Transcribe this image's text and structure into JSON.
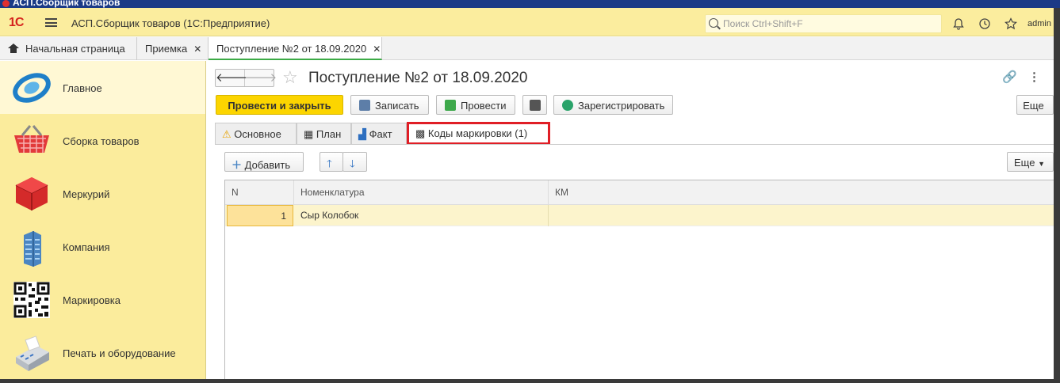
{
  "os": {
    "title": "АСП.Сборщик товаров"
  },
  "header": {
    "logo": "1С",
    "app_title": "АСП.Сборщик товаров  (1С:Предприятие)",
    "search_placeholder": "Поиск Ctrl+Shift+F",
    "user": "admin",
    "icons": [
      "bell-icon",
      "history-icon",
      "star-icon"
    ]
  },
  "open_windows": [
    {
      "label": "Начальная страница",
      "icon": "home-icon"
    },
    {
      "label": "Приемка",
      "closable": true
    },
    {
      "label": "Поступление №2 от 18.09.2020",
      "closable": true,
      "active": true
    }
  ],
  "sidebar": {
    "items": [
      {
        "label": "Главное",
        "icon": "main-section-icon",
        "active": true
      },
      {
        "label": "Сборка товаров",
        "icon": "basket-icon"
      },
      {
        "label": "Меркурий",
        "icon": "cube-icon"
      },
      {
        "label": "Компания",
        "icon": "building-icon"
      },
      {
        "label": "Маркировка",
        "icon": "qr-code-icon"
      },
      {
        "label": "Печать и оборудование",
        "icon": "cash-register-icon"
      }
    ]
  },
  "document": {
    "title": "Поступление №2 от 18.09.2020",
    "toolbar": {
      "post_close": "Провести и закрыть",
      "save": "Записать",
      "post": "Провести",
      "register": "Зарегистрировать",
      "more": "Еще"
    },
    "tabs": [
      {
        "label": "Основное",
        "icon": "warning-icon"
      },
      {
        "label": "План",
        "icon": "calculator-icon"
      },
      {
        "label": "Факт",
        "icon": "chart-icon"
      },
      {
        "label": "Коды маркировки  (1)",
        "icon": "qr-code-icon",
        "selected": true
      }
    ],
    "table_toolbar": {
      "add": "Добавить",
      "more": "Еще"
    },
    "table": {
      "columns": [
        "N",
        "Номенклатура",
        "КМ"
      ],
      "rows": [
        {
          "n": "1",
          "item": "Сыр Колобок",
          "km": ""
        }
      ]
    }
  },
  "colors": {
    "accent": "#fcd500",
    "header_bg": "#fbed9e",
    "highlight": "#e01e26",
    "active_tab": "#3cab46"
  }
}
